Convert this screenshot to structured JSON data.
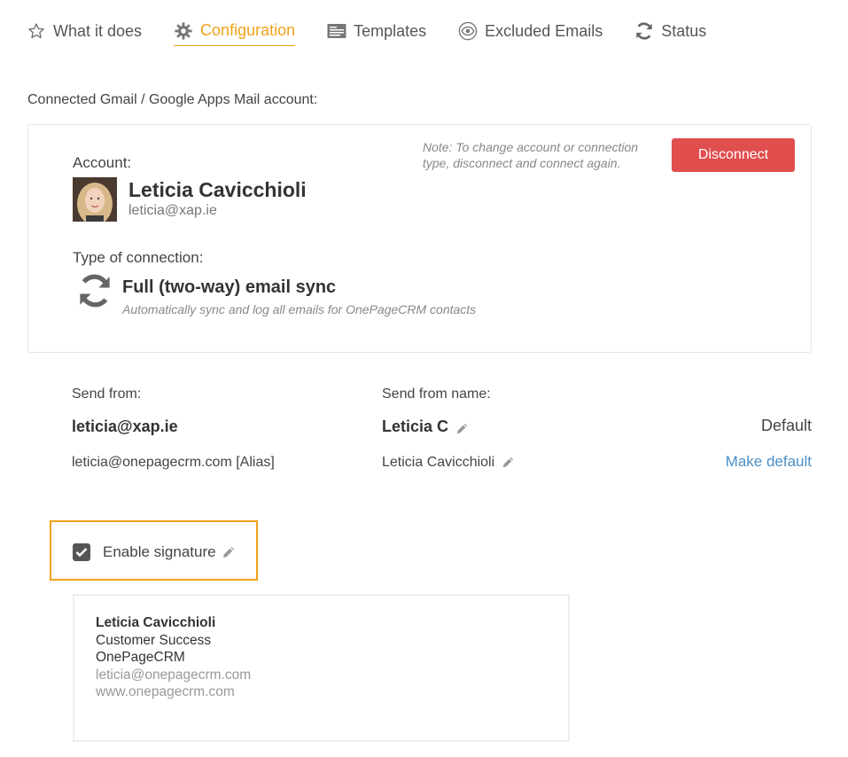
{
  "tabs": [
    {
      "label": "What it does",
      "icon": "star-icon"
    },
    {
      "label": "Configuration",
      "icon": "gear-icon",
      "active": true
    },
    {
      "label": "Templates",
      "icon": "template-icon"
    },
    {
      "label": "Excluded Emails",
      "icon": "eye-icon"
    },
    {
      "label": "Status",
      "icon": "sync-icon"
    }
  ],
  "connected_label": "Connected Gmail / Google Apps Mail account:",
  "account": {
    "label": "Account:",
    "name": "Leticia Cavicchioli",
    "email": "leticia@xap.ie",
    "note": "Note: To change account or connection type, disconnect and connect again.",
    "disconnect_label": "Disconnect",
    "type_label": "Type of connection:",
    "sync_title": "Full (two-way) email sync",
    "sync_subtitle": "Automatically sync and log all emails for OnePageCRM contacts"
  },
  "send_from": {
    "header_from": "Send from:",
    "header_name": "Send from name:",
    "rows": [
      {
        "email": "leticia@xap.ie",
        "name": "Leticia C",
        "status": "Default"
      },
      {
        "email": "leticia@onepagecrm.com [Alias]",
        "name": "Leticia Cavicchioli",
        "status": "Make default"
      }
    ]
  },
  "signature": {
    "enable_label": "Enable signature",
    "enabled": true,
    "lines": [
      "Leticia Cavicchioli",
      "Customer Success",
      "OnePageCRM",
      "leticia@onepagecrm.com",
      "www.onepagecrm.com"
    ]
  },
  "colors": {
    "accent": "#f0a21a",
    "danger": "#e04e4e",
    "link": "#4a90c8"
  }
}
